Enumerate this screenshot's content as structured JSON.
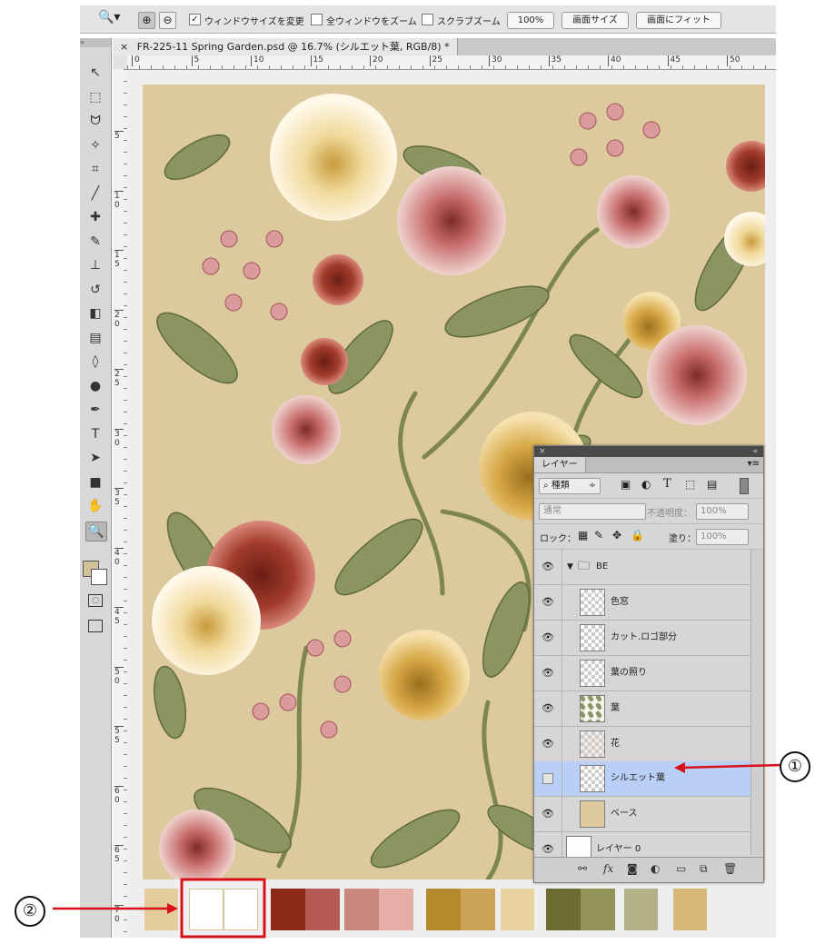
{
  "options_bar": {
    "checkbox_resize_windows": "ウィンドウサイズを変更",
    "checkbox_resize_windows_checked": true,
    "checkbox_zoom_all": "全ウィンドウをズーム",
    "checkbox_scrubby": "スクラブズーム",
    "btn_100": "100%",
    "btn_screen_size": "画面サイズ",
    "btn_fit_screen": "画面にフィット"
  },
  "document": {
    "tab_title": "FR-225-11 Spring Garden.psd @ 16.7% (シルエット葉, RGB/8) *",
    "close_glyph": "×"
  },
  "rulers": {
    "top": [
      "0",
      "5",
      "10",
      "15",
      "20",
      "25",
      "30",
      "35",
      "40",
      "45",
      "50"
    ],
    "left": [
      "5",
      "1\n0",
      "1\n5",
      "2\n0",
      "2\n5",
      "3\n0",
      "3\n5",
      "4\n0",
      "4\n5",
      "5\n0",
      "5\n5",
      "6\n0",
      "6\n5",
      "7\n0"
    ]
  },
  "tools": [
    {
      "name": "move-tool-icon",
      "glyph": "↖"
    },
    {
      "name": "marquee-tool-icon",
      "glyph": "⬚"
    },
    {
      "name": "lasso-tool-icon",
      "glyph": "ᗢ"
    },
    {
      "name": "magic-wand-icon",
      "glyph": "✧"
    },
    {
      "name": "crop-tool-icon",
      "glyph": "⌗"
    },
    {
      "name": "eyedropper-icon",
      "glyph": "╱"
    },
    {
      "name": "healing-brush-icon",
      "glyph": "✚"
    },
    {
      "name": "brush-tool-icon",
      "glyph": "✎"
    },
    {
      "name": "clone-stamp-icon",
      "glyph": "⊥"
    },
    {
      "name": "history-brush-icon",
      "glyph": "↺"
    },
    {
      "name": "eraser-tool-icon",
      "glyph": "◧"
    },
    {
      "name": "gradient-tool-icon",
      "glyph": "▤"
    },
    {
      "name": "blur-tool-icon",
      "glyph": "◊"
    },
    {
      "name": "dodge-tool-icon",
      "glyph": "●"
    },
    {
      "name": "pen-tool-icon",
      "glyph": "✒"
    },
    {
      "name": "type-tool-icon",
      "glyph": "T"
    },
    {
      "name": "path-selection-icon",
      "glyph": "➤"
    },
    {
      "name": "shape-tool-icon",
      "glyph": "■"
    },
    {
      "name": "hand-tool-icon",
      "glyph": "✋"
    },
    {
      "name": "zoom-tool-icon",
      "glyph": "🔍"
    }
  ],
  "colors": {
    "foreground": "#d3c299",
    "background": "#ffffff",
    "annotation_red": "#d9101a",
    "selected_layer": "#b9cff5",
    "artwork_base": "#dcc99d"
  },
  "swatches": [
    [
      "#e3cd9d"
    ],
    [
      "#ffffff",
      "#ffffff"
    ],
    [
      "#8b2818",
      "#b75a55"
    ],
    [
      "#c9877d",
      "#e4aea4"
    ],
    [
      "#b58a2c",
      "#cca359"
    ],
    [
      "#e8d2a0"
    ],
    [
      "#6b6b32",
      "#939457"
    ],
    [
      "#b4b086"
    ],
    [
      "#d6b978"
    ]
  ],
  "layers_panel": {
    "title": "レイヤー",
    "filter_label": "種類",
    "blend_mode": "通常",
    "opacity_label": "不透明度：",
    "opacity_value": "100%",
    "lock_label": "ロック：",
    "fill_label": "塗り：",
    "fill_value": "100%",
    "layers": [
      {
        "name": "BE",
        "group": true,
        "visible": true,
        "selected": false
      },
      {
        "name": "色窓",
        "group": false,
        "visible": true,
        "selected": false,
        "thumb": "transparent"
      },
      {
        "name": "カット.ロゴ部分",
        "group": false,
        "visible": true,
        "selected": false,
        "thumb": "transparent"
      },
      {
        "name": "葉の照り",
        "group": false,
        "visible": true,
        "selected": false,
        "thumb": "transparent"
      },
      {
        "name": "葉",
        "group": false,
        "visible": true,
        "selected": false,
        "thumb": "leaves"
      },
      {
        "name": "花",
        "group": false,
        "visible": true,
        "selected": false,
        "thumb": "flowers"
      },
      {
        "name": "シルエット葉",
        "group": false,
        "visible": false,
        "selected": true,
        "thumb": "transparent"
      },
      {
        "name": "ベース",
        "group": false,
        "visible": true,
        "selected": false,
        "thumb": "base"
      },
      {
        "name": "レイヤー 0",
        "group": false,
        "visible": true,
        "selected": false,
        "thumb": "white"
      }
    ]
  },
  "annotations": {
    "label_1": "①",
    "label_2": "②"
  }
}
